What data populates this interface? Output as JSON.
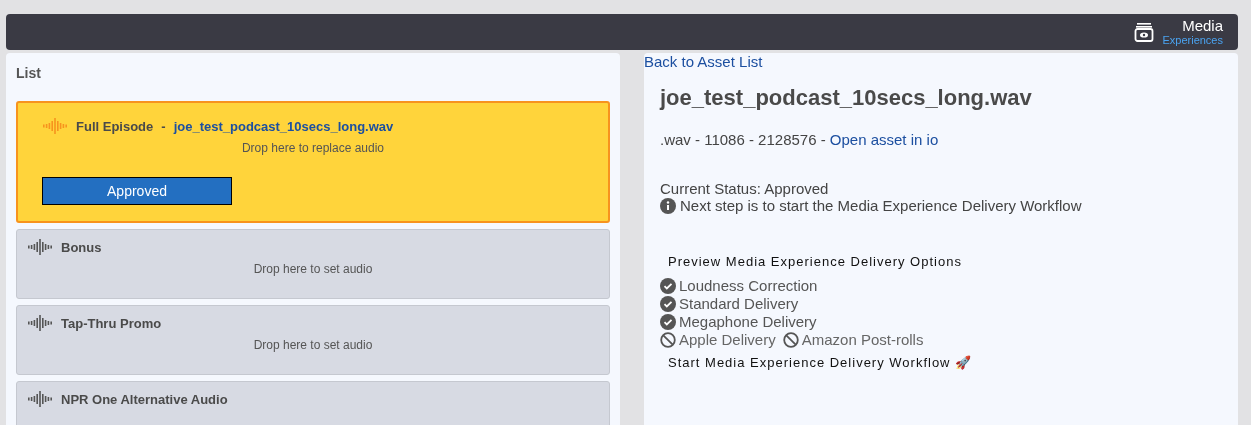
{
  "header": {
    "title": "Media",
    "subtitle": "Experiences"
  },
  "list": {
    "title": "List",
    "items": [
      {
        "name": "Full Episode",
        "separator": "-",
        "file": "joe_test_podcast_10secs_long.wav",
        "drop_hint": "Drop here to replace audio",
        "status": "Approved",
        "selected": true
      },
      {
        "name": "Bonus",
        "drop_hint": "Drop here to set audio",
        "selected": false
      },
      {
        "name": "Tap-Thru Promo",
        "drop_hint": "Drop here to set audio",
        "selected": false
      },
      {
        "name": "NPR One Alternative Audio",
        "selected": false
      }
    ]
  },
  "detail": {
    "back_link": "Back to Asset List",
    "title": "joe_test_podcast_10secs_long.wav",
    "meta": ".wav - 11086 - 2128576 - ",
    "meta_link": "Open asset in io",
    "status": "Current Status: Approved",
    "next_step": "Next step is to start the Media Experience Delivery Workflow",
    "options_title": "Preview Media Experience Delivery Options",
    "option_rows": [
      {
        "options": [
          {
            "label": "Loudness Correction",
            "enabled": true
          }
        ]
      },
      {
        "options": [
          {
            "label": "Standard Delivery",
            "enabled": true
          }
        ]
      },
      {
        "options": [
          {
            "label": "Megaphone Delivery",
            "enabled": true
          }
        ]
      },
      {
        "options": [
          {
            "label": "Apple Delivery",
            "enabled": false
          },
          {
            "label": "Amazon Post-rolls",
            "enabled": false
          }
        ]
      }
    ],
    "start_button": "Start Media Experience Delivery Workflow 🚀"
  }
}
